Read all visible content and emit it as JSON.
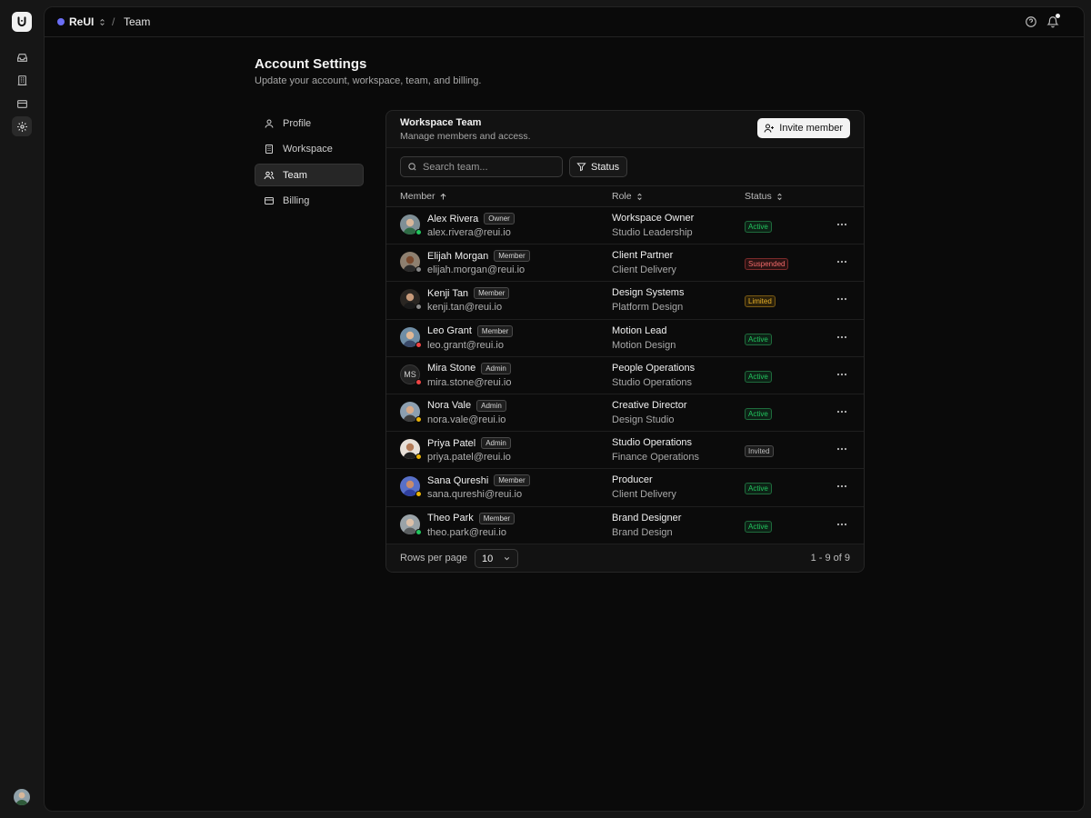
{
  "app": {
    "workspace_name": "ReUI",
    "breadcrumb_current": "Team"
  },
  "page": {
    "title": "Account Settings",
    "subtitle": "Update your account, workspace, team, and billing."
  },
  "settings_nav": [
    {
      "label": "Profile",
      "icon": "user-icon"
    },
    {
      "label": "Workspace",
      "icon": "building-icon"
    },
    {
      "label": "Team",
      "icon": "users-icon",
      "active": true
    },
    {
      "label": "Billing",
      "icon": "credit-card-icon"
    }
  ],
  "card": {
    "title": "Workspace Team",
    "subtitle": "Manage members and access.",
    "invite_label": "Invite member"
  },
  "toolbar": {
    "search_placeholder": "Search team...",
    "status_filter_label": "Status"
  },
  "table": {
    "columns": {
      "member": "Member",
      "role": "Role",
      "status": "Status"
    },
    "rows": [
      {
        "name": "Alex Rivera",
        "tag": "Owner",
        "email": "alex.rivera@reui.io",
        "role": "Workspace Owner",
        "team": "Studio Leadership",
        "status": "Active",
        "status_kind": "active",
        "presence": "#22c55e"
      },
      {
        "name": "Elijah Morgan",
        "tag": "Member",
        "email": "elijah.morgan@reui.io",
        "role": "Client Partner",
        "team": "Client Delivery",
        "status": "Suspended",
        "status_kind": "suspended",
        "presence": "#8a8a8a"
      },
      {
        "name": "Kenji Tan",
        "tag": "Member",
        "email": "kenji.tan@reui.io",
        "role": "Design Systems",
        "team": "Platform Design",
        "status": "Limited",
        "status_kind": "limited",
        "presence": "#8a8a8a"
      },
      {
        "name": "Leo Grant",
        "tag": "Member",
        "email": "leo.grant@reui.io",
        "role": "Motion Lead",
        "team": "Motion Design",
        "status": "Active",
        "status_kind": "active",
        "presence": "#ef4444"
      },
      {
        "name": "Mira Stone",
        "tag": "Admin",
        "email": "mira.stone@reui.io",
        "role": "People Operations",
        "team": "Studio Operations",
        "status": "Active",
        "status_kind": "active",
        "presence": "#ef4444",
        "initials": "MS"
      },
      {
        "name": "Nora Vale",
        "tag": "Admin",
        "email": "nora.vale@reui.io",
        "role": "Creative Director",
        "team": "Design Studio",
        "status": "Active",
        "status_kind": "active",
        "presence": "#eab308"
      },
      {
        "name": "Priya Patel",
        "tag": "Admin",
        "email": "priya.patel@reui.io",
        "role": "Studio Operations",
        "team": "Finance Operations",
        "status": "Invited",
        "status_kind": "invited",
        "presence": "#eab308"
      },
      {
        "name": "Sana Qureshi",
        "tag": "Member",
        "email": "sana.qureshi@reui.io",
        "role": "Producer",
        "team": "Client Delivery",
        "status": "Active",
        "status_kind": "active",
        "presence": "#eab308"
      },
      {
        "name": "Theo Park",
        "tag": "Member",
        "email": "theo.park@reui.io",
        "role": "Brand Designer",
        "team": "Brand Design",
        "status": "Active",
        "status_kind": "active",
        "presence": "#22c55e"
      }
    ]
  },
  "footer": {
    "rows_per_page_label": "Rows per page",
    "rows_per_page_value": "10",
    "pagination": "1 - 9 of 9"
  }
}
